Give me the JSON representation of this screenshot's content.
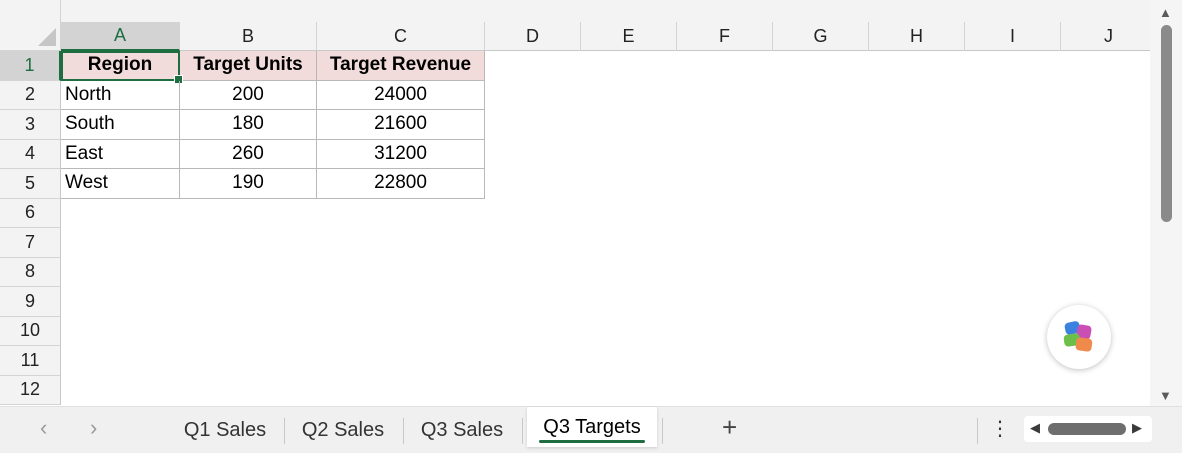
{
  "sheet": {
    "columns": [
      "A",
      "B",
      "C",
      "D",
      "E",
      "F",
      "G",
      "H",
      "I",
      "J"
    ],
    "rows": [
      "1",
      "2",
      "3",
      "4",
      "5",
      "6",
      "7",
      "8",
      "9",
      "10",
      "11",
      "12"
    ],
    "selected_cell": "A1",
    "cells": {
      "A1": "Region",
      "B1": "Target Units",
      "C1": "Target Revenue",
      "A2": "North",
      "B2": "200",
      "C2": "24000",
      "A3": "South",
      "B3": "180",
      "C3": "21600",
      "A4": "East",
      "B4": "260",
      "C4": "31200",
      "A5": "West",
      "B5": "190",
      "C5": "22800"
    },
    "header_fill": "#f2dcdb",
    "accent": "#1e6e42"
  },
  "tabs": [
    {
      "label": "Q1 Sales",
      "active": false
    },
    {
      "label": "Q2 Sales",
      "active": false
    },
    {
      "label": "Q3 Sales",
      "active": false
    },
    {
      "label": "Q3 Targets",
      "active": true
    }
  ],
  "icons": {
    "prev": "‹",
    "next": "›",
    "add": "+",
    "more": "⋮",
    "up": "▲",
    "down": "▼",
    "left": "◀",
    "right": "▶"
  }
}
